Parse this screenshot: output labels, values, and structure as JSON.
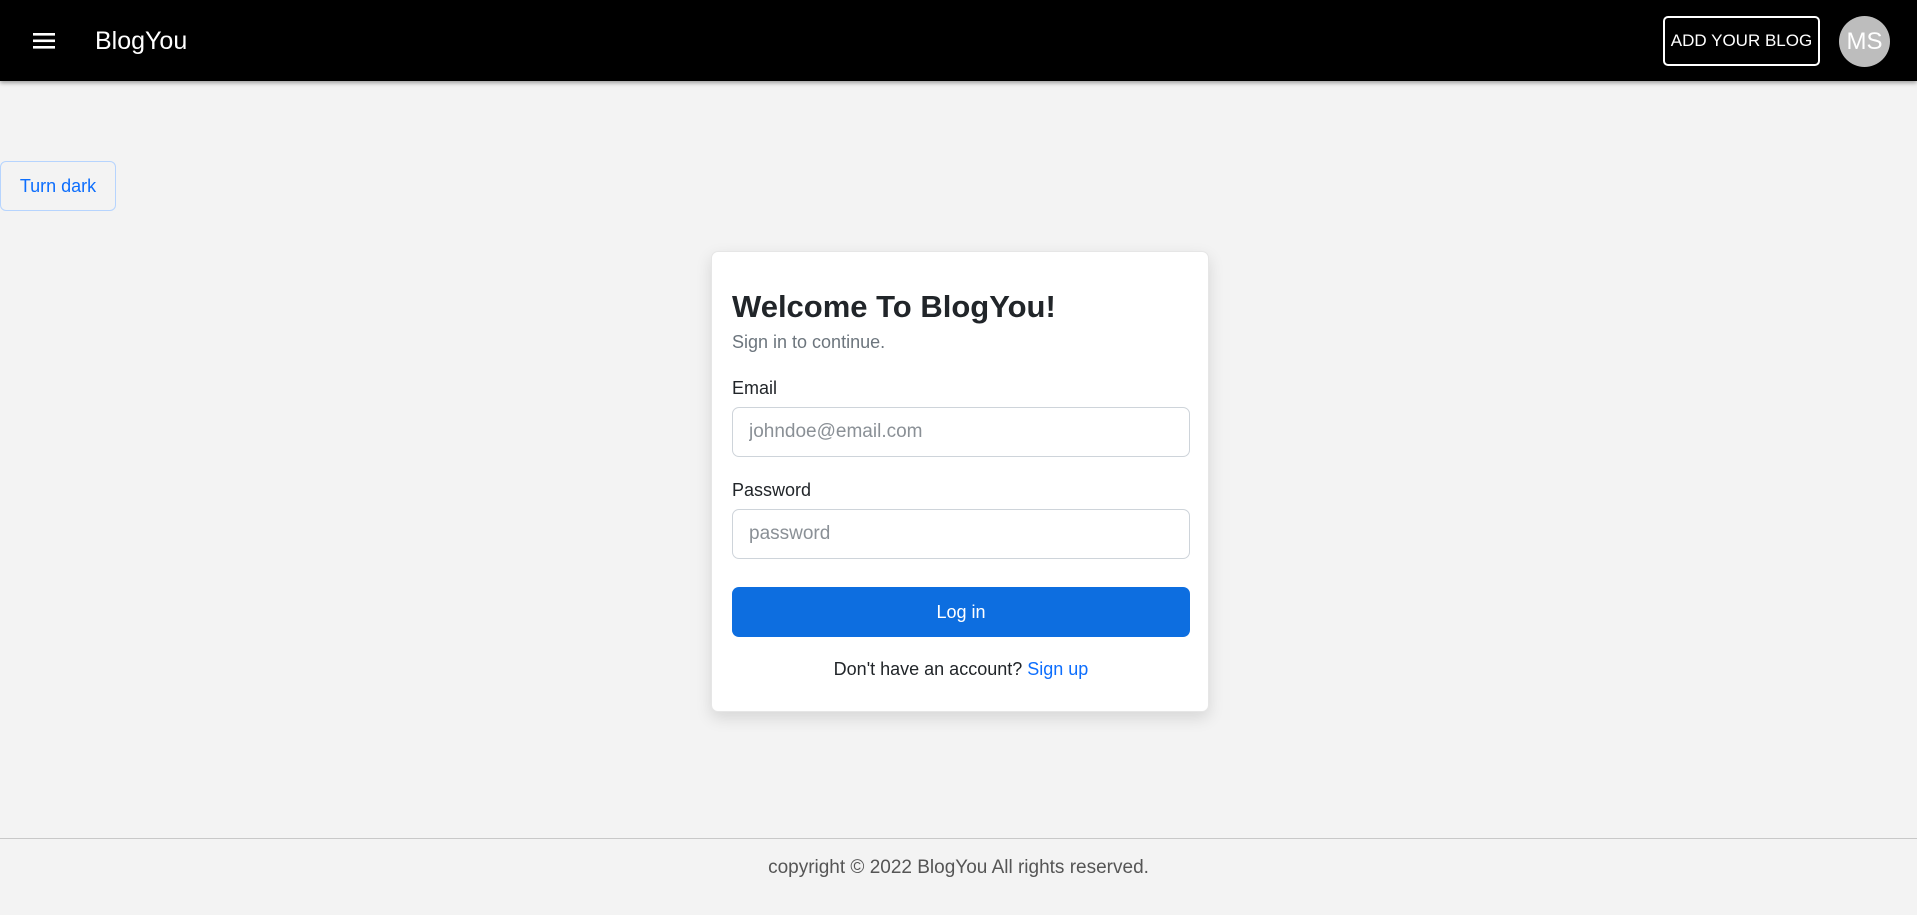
{
  "header": {
    "menu_icon": "hamburger-menu-icon",
    "brand": "BlogYou",
    "add_blog_label": "ADD YOUR BLOG",
    "avatar_initials": "MS"
  },
  "theme_toggle": {
    "label": "Turn dark"
  },
  "login_card": {
    "title": "Welcome To BlogYou!",
    "subtitle": "Sign in to continue.",
    "email_label": "Email",
    "email_placeholder": "johndoe@email.com",
    "email_value": "",
    "password_label": "Password",
    "password_placeholder": "password",
    "password_value": "",
    "login_label": "Log in",
    "signup_prompt": "Don't have an account?",
    "signup_link": "Sign up"
  },
  "footer": {
    "text": "copyright © 2022 BlogYou All rights reserved."
  },
  "colors": {
    "header_bg": "#000000",
    "page_bg": "#f3f3f3",
    "primary": "#0d6ee0",
    "link": "#0d6efd",
    "avatar_bg": "#bdbdbd"
  }
}
